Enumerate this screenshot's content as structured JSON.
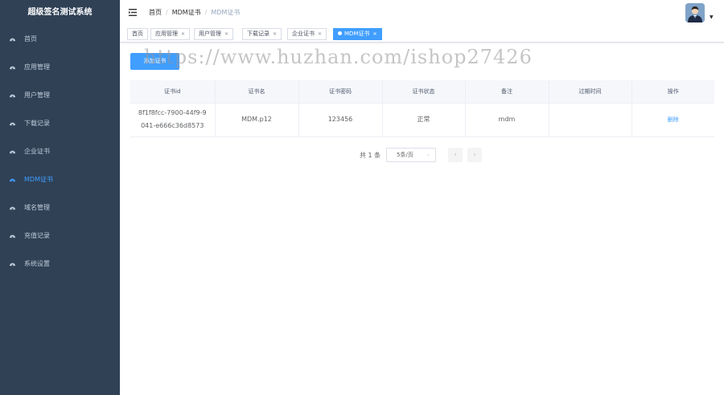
{
  "app": {
    "title": "超级签名测试系统"
  },
  "sidebar": {
    "items": [
      {
        "label": "首页",
        "icon": "dashboard-icon",
        "active": false
      },
      {
        "label": "应用管理",
        "icon": "dashboard-icon",
        "active": false
      },
      {
        "label": "用户管理",
        "icon": "dashboard-icon",
        "active": false
      },
      {
        "label": "下载记录",
        "icon": "dashboard-icon",
        "active": false
      },
      {
        "label": "企业证书",
        "icon": "dashboard-icon",
        "active": false
      },
      {
        "label": "MDM证书",
        "icon": "dashboard-icon",
        "active": true
      },
      {
        "label": "域名管理",
        "icon": "dashboard-icon",
        "active": false
      },
      {
        "label": "充值记录",
        "icon": "dashboard-icon",
        "active": false
      },
      {
        "label": "系统设置",
        "icon": "dashboard-icon",
        "active": false
      }
    ]
  },
  "breadcrumb": {
    "items": [
      "首页",
      "MDM证书",
      "MDM证书"
    ],
    "separator": "/"
  },
  "tags": [
    {
      "label": "首页",
      "closable": false,
      "active": false
    },
    {
      "label": "应用管理",
      "closable": true,
      "active": false
    },
    {
      "label": "用户管理",
      "closable": true,
      "active": false
    },
    {
      "label": "下载记录",
      "closable": true,
      "active": false
    },
    {
      "label": "企业证书",
      "closable": true,
      "active": false
    },
    {
      "label": "MDM证书",
      "closable": true,
      "active": true
    }
  ],
  "toolbar": {
    "add_label": "添加证书"
  },
  "watermark": "https://www.huzhan.com/ishop27426",
  "table": {
    "columns": [
      "证书id",
      "证书名",
      "证书密码",
      "证书状态",
      "备注",
      "过期时间",
      "操作"
    ],
    "rows": [
      {
        "id_line1": "8f1f8fcc-7900-44f9-9",
        "id_line2": "041-e666c36d8573",
        "name": "MDM.p12",
        "password": "123456",
        "status": "正常",
        "remark": "mdm",
        "expire": "",
        "action": "删除"
      }
    ]
  },
  "pagination": {
    "total_text": "共 1 条",
    "page_size": "5条/页",
    "prev": "‹",
    "next": "›"
  },
  "colors": {
    "sidebar_bg": "#304156",
    "sidebar_text": "#bfcbd9",
    "accent": "#409eff"
  }
}
